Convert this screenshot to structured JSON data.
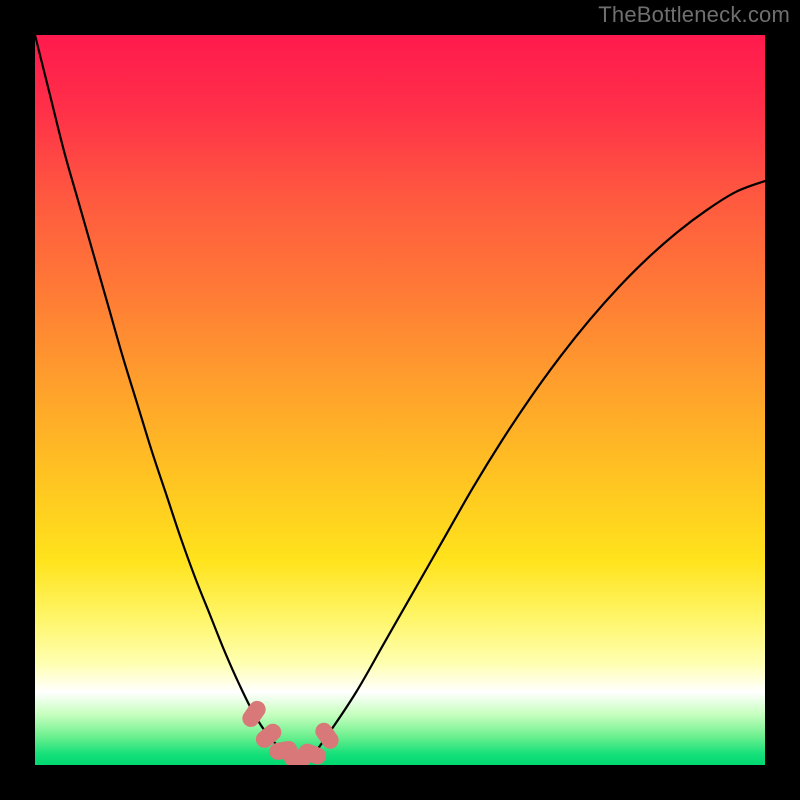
{
  "watermark": "TheBottleneck.com",
  "colors": {
    "frame": "#000000",
    "gradient_stops": [
      {
        "offset": 0.0,
        "color": "#ff1a4d"
      },
      {
        "offset": 0.1,
        "color": "#ff2f49"
      },
      {
        "offset": 0.22,
        "color": "#ff5840"
      },
      {
        "offset": 0.35,
        "color": "#ff7a36"
      },
      {
        "offset": 0.48,
        "color": "#ffa02c"
      },
      {
        "offset": 0.6,
        "color": "#ffc222"
      },
      {
        "offset": 0.72,
        "color": "#ffe31c"
      },
      {
        "offset": 0.8,
        "color": "#fff66a"
      },
      {
        "offset": 0.86,
        "color": "#ffffb0"
      },
      {
        "offset": 0.9,
        "color": "#ffffff"
      },
      {
        "offset": 0.93,
        "color": "#c8ffc0"
      },
      {
        "offset": 0.96,
        "color": "#70f090"
      },
      {
        "offset": 0.985,
        "color": "#16e07a"
      },
      {
        "offset": 1.0,
        "color": "#00d870"
      }
    ],
    "curve": "#000000",
    "marker": "#d87878"
  },
  "chart_data": {
    "type": "line",
    "title": "",
    "xlabel": "",
    "ylabel": "",
    "xlim": [
      0,
      100
    ],
    "ylim": [
      0,
      100
    ],
    "grid": false,
    "legend": false,
    "series": [
      {
        "name": "bottleneck-curve",
        "x": [
          0,
          2,
          4,
          6,
          8,
          10,
          12,
          14,
          16,
          18,
          20,
          22,
          24,
          26,
          28,
          30,
          32,
          34,
          36,
          38,
          40,
          44,
          48,
          52,
          56,
          60,
          64,
          68,
          72,
          76,
          80,
          84,
          88,
          92,
          96,
          100
        ],
        "y": [
          100,
          92,
          84,
          77,
          70,
          63,
          56,
          49.5,
          43,
          37,
          31,
          25.5,
          20.5,
          15.5,
          11,
          7,
          4,
          2,
          1,
          1.5,
          4,
          10,
          17,
          24,
          31,
          38,
          44.5,
          50.5,
          56,
          61,
          65.5,
          69.5,
          73,
          76,
          78.5,
          80
        ]
      }
    ],
    "markers": {
      "name": "highlighted-points",
      "points": [
        {
          "x": 30,
          "y": 7
        },
        {
          "x": 32,
          "y": 4
        },
        {
          "x": 34,
          "y": 2
        },
        {
          "x": 36,
          "y": 1
        },
        {
          "x": 38,
          "y": 1.5
        },
        {
          "x": 40,
          "y": 4
        }
      ]
    }
  }
}
